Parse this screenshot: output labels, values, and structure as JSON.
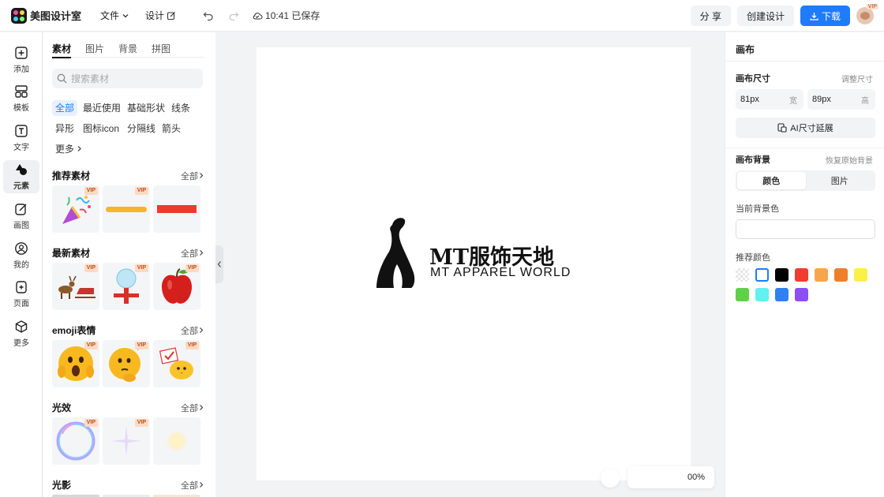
{
  "app": {
    "name": "美图设计室",
    "menus": [
      "文件",
      "设计"
    ],
    "saved_status": "10:41 已保存"
  },
  "topbar": {
    "share_label": "分 享",
    "create_label": "创建设计",
    "download_label": "下载",
    "avatar_badge": "VIP"
  },
  "rail": {
    "items": [
      {
        "label": "添加",
        "icon": "plus-square-icon"
      },
      {
        "label": "模板",
        "icon": "template-grid-icon"
      },
      {
        "label": "文字",
        "icon": "text-t-icon"
      },
      {
        "label": "元素",
        "icon": "shapes-icon",
        "active": true
      },
      {
        "label": "画图",
        "icon": "pencil-edit-icon"
      },
      {
        "label": "我的",
        "icon": "user-icon"
      },
      {
        "label": "页面",
        "icon": "page-add-icon"
      },
      {
        "label": "更多",
        "icon": "cube-icon"
      }
    ]
  },
  "panel": {
    "tabs": [
      "素材",
      "图片",
      "背景",
      "拼图"
    ],
    "search_placeholder": "搜索素材",
    "chips": [
      "全部",
      "最近使用",
      "基础形状",
      "线条",
      "异形",
      "图标icon",
      "分隔线",
      "箭头",
      "更多"
    ],
    "all_label": "全部",
    "vip_label": "VIP",
    "sections": [
      {
        "title": "推荐素材",
        "thumbs": [
          "party-popper",
          "yellow-brush-stroke",
          "red-bar"
        ]
      },
      {
        "title": "最新素材",
        "thumbs": [
          "reindeer-sleigh",
          "snow-globe-gift",
          "red-apple"
        ]
      },
      {
        "title": "emoji表情",
        "thumbs": [
          "shocked-emoji",
          "thinking-emoji",
          "chick-sign-emoji"
        ]
      },
      {
        "title": "光效",
        "thumbs": [
          "bubble-ring",
          "sparkle-star",
          "soft-glow"
        ]
      },
      {
        "title": "光影",
        "thumbs": []
      }
    ]
  },
  "canvas": {
    "brand_cn": "MT服饰天地",
    "brand_en": "MT APPAREL WORLD",
    "zoom": "00%"
  },
  "props": {
    "title": "画布",
    "size_label": "画布尺寸",
    "resize_label": "调整尺寸",
    "width_value": "81px",
    "width_unit": "宽",
    "height_value": "89px",
    "height_unit": "高",
    "ai_extend_label": "AI尺寸延展",
    "bg_label": "画布背景",
    "restore_bg_label": "恢复原始背景",
    "bg_tabs": [
      "颜色",
      "图片"
    ],
    "current_bg_label": "当前背景色",
    "current_bg_color": "#ffffff",
    "recommended_label": "推荐颜色",
    "swatches": [
      "transparent",
      "#ffffff",
      "#000000",
      "#ef3d2f",
      "#f6a54d",
      "#f07f2b",
      "#fbf048",
      "#5fd148",
      "#62f0f0",
      "#2f80f0",
      "#8c4ff2"
    ],
    "accent_color": "#1f7bff"
  }
}
